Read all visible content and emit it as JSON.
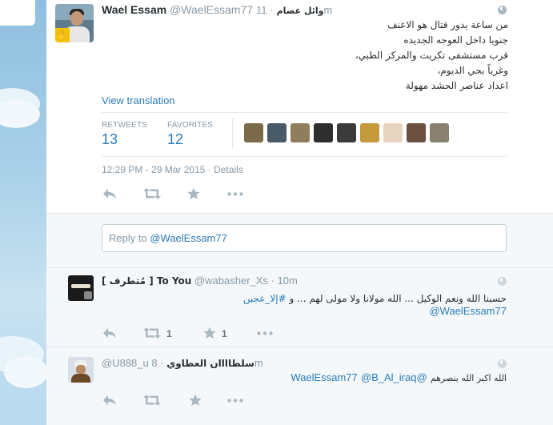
{
  "main_tweet": {
    "name": "Wael Essam",
    "handle": "@WaelEssam77",
    "arabic_name": "وائل عصام",
    "separator": "·",
    "time": "11m",
    "text_lines": [
      "من ساعة يدور قتال هو الاعنف",
      "جنوبا داخل العوجه الجديده",
      "قرب مستشفى تكريت والمركز الطبي،",
      "وغرباً بحي الديوم،",
      "اعداد عناصر الحشد مهولة"
    ],
    "view_translation": "View translation",
    "retweets_label": "RETWEETS",
    "retweets_count": "13",
    "favorites_label": "FAVORITES",
    "favorites_count": "12",
    "timestamp": "12:29 PM - 29 Mar 2015",
    "details_link": "Details",
    "favoriter_avatars": [
      "#7b6a4a",
      "#4a5a66",
      "#8f7d5c",
      "#2e2e2e",
      "#3a3a3a",
      "#c49a3a",
      "#e8d4c0",
      "#6b5040",
      "#8a8070"
    ]
  },
  "reply_box": {
    "prefix": "Reply to ",
    "mention": "@WaelEssam77"
  },
  "replies": [
    {
      "name": "[ مُتطرف ] To You",
      "handle": "@wabasher_Xs",
      "separator": "·",
      "time": "10m",
      "text": "حسبنا الله ونعم الوكيل ... الله مولانا ولا مولى لهم ... و ",
      "hashtag": "#إلا_عجبن",
      "mention": "@WaelEssam77",
      "retweet_count": "1",
      "favorite_count": "1"
    },
    {
      "name": "سلطاااان العطاوي",
      "handle": "@U888_u",
      "separator": "·",
      "time": "8m",
      "mention_1": "@WaelEssam77",
      "mention_2": "@B_Al_iraq",
      "text": " الله اكبر الله ينصرهم"
    }
  ],
  "icons": {
    "reply": "reply-icon",
    "retweet": "retweet-icon",
    "favorite": "star-icon",
    "more": "more-icon",
    "globe": "globe-icon"
  },
  "colors": {
    "link": "#2b7bb9",
    "muted": "#8899a6",
    "action_icon": "#aab8c2",
    "background": "#9cc8e3"
  }
}
